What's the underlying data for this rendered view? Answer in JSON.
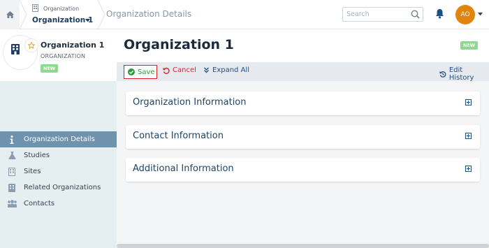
{
  "header": {
    "crumb_small": "Organization",
    "crumb_org": "Organization 1",
    "crumb_current": "Organization Details",
    "search_placeholder": "Search",
    "avatar_initials": "AO"
  },
  "sidebar": {
    "org_name": "Organization 1",
    "org_type": "ORGANIZATION",
    "badge": "NEW",
    "items": [
      {
        "label": "Organization Details",
        "icon": "info-icon",
        "active": true
      },
      {
        "label": "Studies",
        "icon": "flask-icon",
        "active": false
      },
      {
        "label": "Sites",
        "icon": "building-icon",
        "active": false
      },
      {
        "label": "Related Organizations",
        "icon": "building-icon",
        "active": false
      },
      {
        "label": "Contacts",
        "icon": "users-icon",
        "active": false
      }
    ]
  },
  "main": {
    "title": "Organization 1",
    "badge": "NEW",
    "toolbar": {
      "save": "Save",
      "cancel": "Cancel",
      "expand_all": "Expand All",
      "edit_history": "Edit History"
    },
    "panels": [
      {
        "title": "Organization Information"
      },
      {
        "title": "Contact Information"
      },
      {
        "title": "Additional Information"
      }
    ]
  },
  "colors": {
    "accent": "#1d4f87",
    "nav_active": "#6f93ad",
    "badge_green": "#8fd98f",
    "avatar": "#e3830f",
    "danger": "#d8232a",
    "success": "#2a9a3a"
  }
}
